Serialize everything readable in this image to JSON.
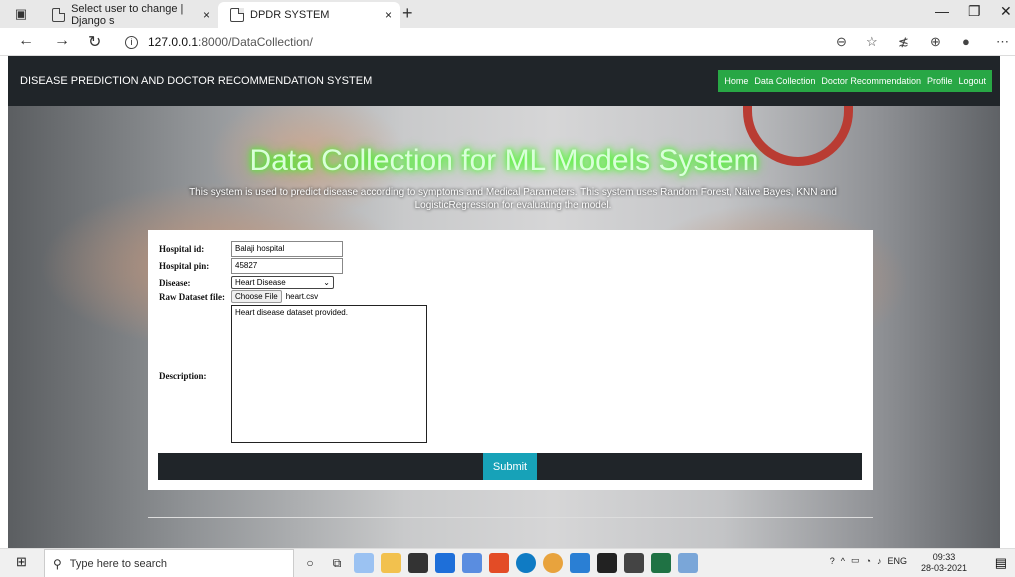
{
  "browser": {
    "tabs": [
      {
        "title": "Select user to change | Django s",
        "close": "×"
      },
      {
        "title": "DPDR SYSTEM",
        "close": "×"
      }
    ],
    "new_tab": "+",
    "address_domain": "127.0.0.1",
    "address_path": ":8000/DataCollection/"
  },
  "site": {
    "brand": "DISEASE PREDICTION AND DOCTOR RECOMMENDATION SYSTEM",
    "nav": [
      "Home",
      "Data Collection",
      "Doctor Recommendation",
      "Profile",
      "Logout"
    ],
    "nav_color": "#28a745",
    "header_color": "#202529"
  },
  "hero": {
    "title": "Data Collection for ML Models System",
    "subtitle": "This system is used to predict disease according to symptoms and Medical Parameters. This system uses Random Forest, Naive Bayes, KNN and LogisticRegression for evaluating the model."
  },
  "form": {
    "hospital_id_label": "Hospital id:",
    "hospital_id_value": "Balaji hospital",
    "hospital_pin_label": "Hospital pin:",
    "hospital_pin_value": "45827",
    "disease_label": "Disease:",
    "disease_value": "Heart Disease",
    "raw_label": "Raw Dataset file:",
    "choose_file": "Choose File",
    "file_name": "heart.csv",
    "description_label": "Description:",
    "description_value": "Heart disease dataset provided.",
    "submit": "Submit",
    "submit_color": "#17a2b8"
  },
  "taskbar": {
    "search_placeholder": "Type here to search",
    "lang": "ENG",
    "time": "09:33",
    "date": "28-03-2021"
  }
}
